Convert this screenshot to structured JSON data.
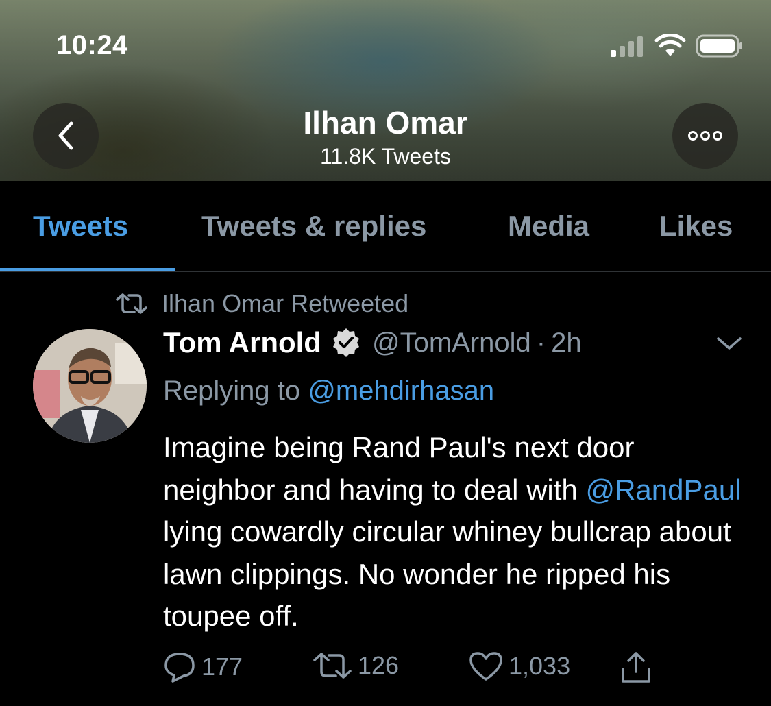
{
  "status_bar": {
    "time": "10:24"
  },
  "header": {
    "profile_name": "Ilhan Omar",
    "tweet_count": "11.8K Tweets",
    "back_icon": "chevron-left-icon",
    "more_icon": "ellipsis-icon"
  },
  "tabs": [
    {
      "label": "Tweets",
      "active": true
    },
    {
      "label": "Tweets & replies",
      "active": false
    },
    {
      "label": "Media",
      "active": false
    },
    {
      "label": "Likes",
      "active": false
    }
  ],
  "tweet": {
    "retweet_label": "Ilhan Omar Retweeted",
    "author_name": "Tom Arnold",
    "verified": true,
    "handle": "@TomArnold",
    "separator": "·",
    "time": "2h",
    "replying_prefix": "Replying to",
    "replying_to": "@mehdirhasan",
    "text_part1": "Imagine being Rand Paul's next door neighbor and having to deal with",
    "mention": "@RandPaul",
    "text_part2": "lying cowardly circular whiney bullcrap about lawn clippings. No wonder he ripped his toupee off.",
    "replies": "177",
    "retweets": "126",
    "likes": "1,033"
  },
  "colors": {
    "accent": "#4a9de3",
    "muted": "#8b98a5",
    "background": "#000000"
  }
}
